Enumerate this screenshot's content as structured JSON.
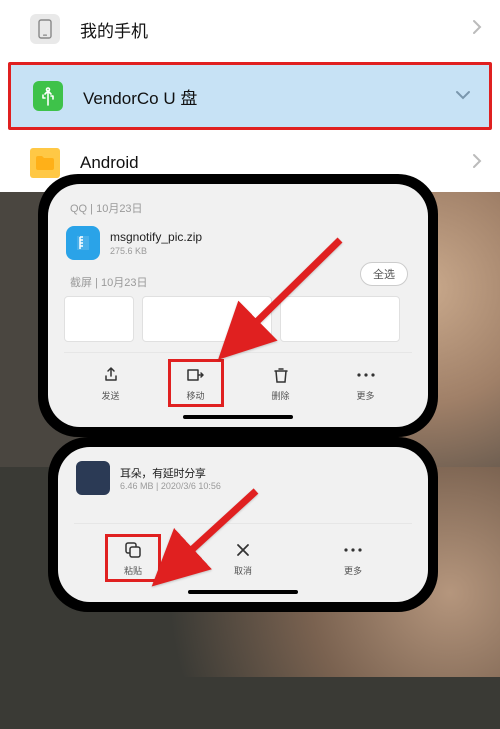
{
  "top": {
    "phone_label": "我的手机",
    "usb_label": "VendorCo U 盘",
    "folder_label": "Android"
  },
  "mid": {
    "section1": "QQ  |  10月23日",
    "file_name": "msgnotify_pic.zip",
    "file_size": "275.6 KB",
    "section2": "截屏  |  10月23日",
    "select_all": "全选",
    "tb_send": "发送",
    "tb_move": "移动",
    "tb_delete": "删除",
    "tb_more": "更多"
  },
  "bot": {
    "audio_name": "耳朵，有延时分享",
    "audio_meta": "6.46 MB  |  2020/3/6  10:56",
    "tb_paste": "粘贴",
    "tb_cancel": "取消",
    "tb_more": "更多"
  }
}
